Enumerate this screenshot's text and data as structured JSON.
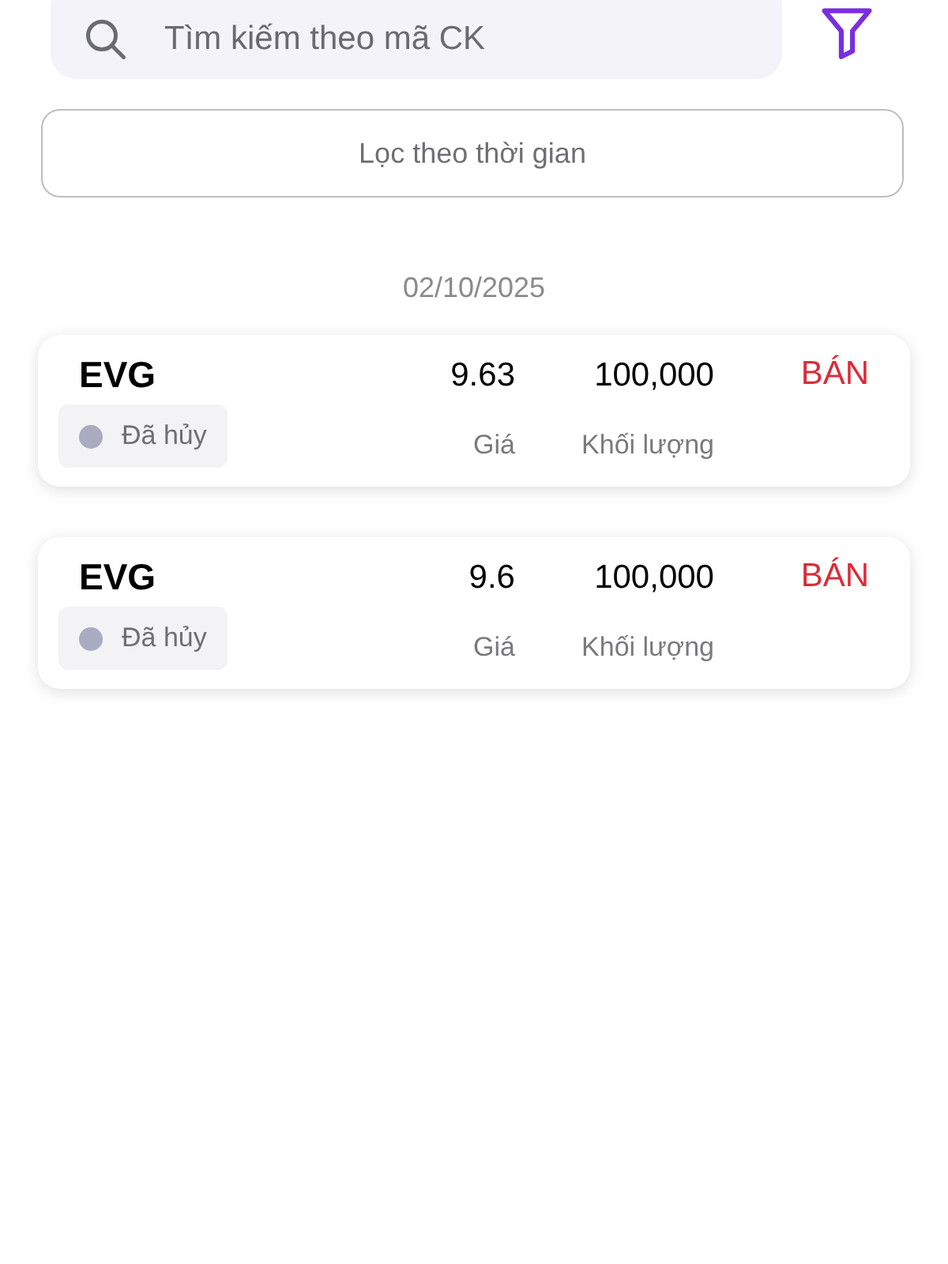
{
  "search": {
    "placeholder": "Tìm kiếm theo mã CK"
  },
  "time_filter_button": "Lọc theo thời gian",
  "date": "02/10/2025",
  "orders": [
    {
      "symbol": "EVG",
      "price": "9.63",
      "volume": "100,000",
      "side": "BÁN",
      "kind": "sell",
      "status": "Đã hủy",
      "color": "#a9abc0",
      "price_label": "Giá",
      "volume_label": "Khối lượng"
    },
    {
      "symbol": "EVG",
      "price": "9.6",
      "volume": "100,000",
      "side": "BÁN",
      "kind": "sell",
      "status": "Đã hủy",
      "color": "#a9abc0",
      "price_label": "Giá",
      "volume_label": "Khối lượng"
    }
  ]
}
